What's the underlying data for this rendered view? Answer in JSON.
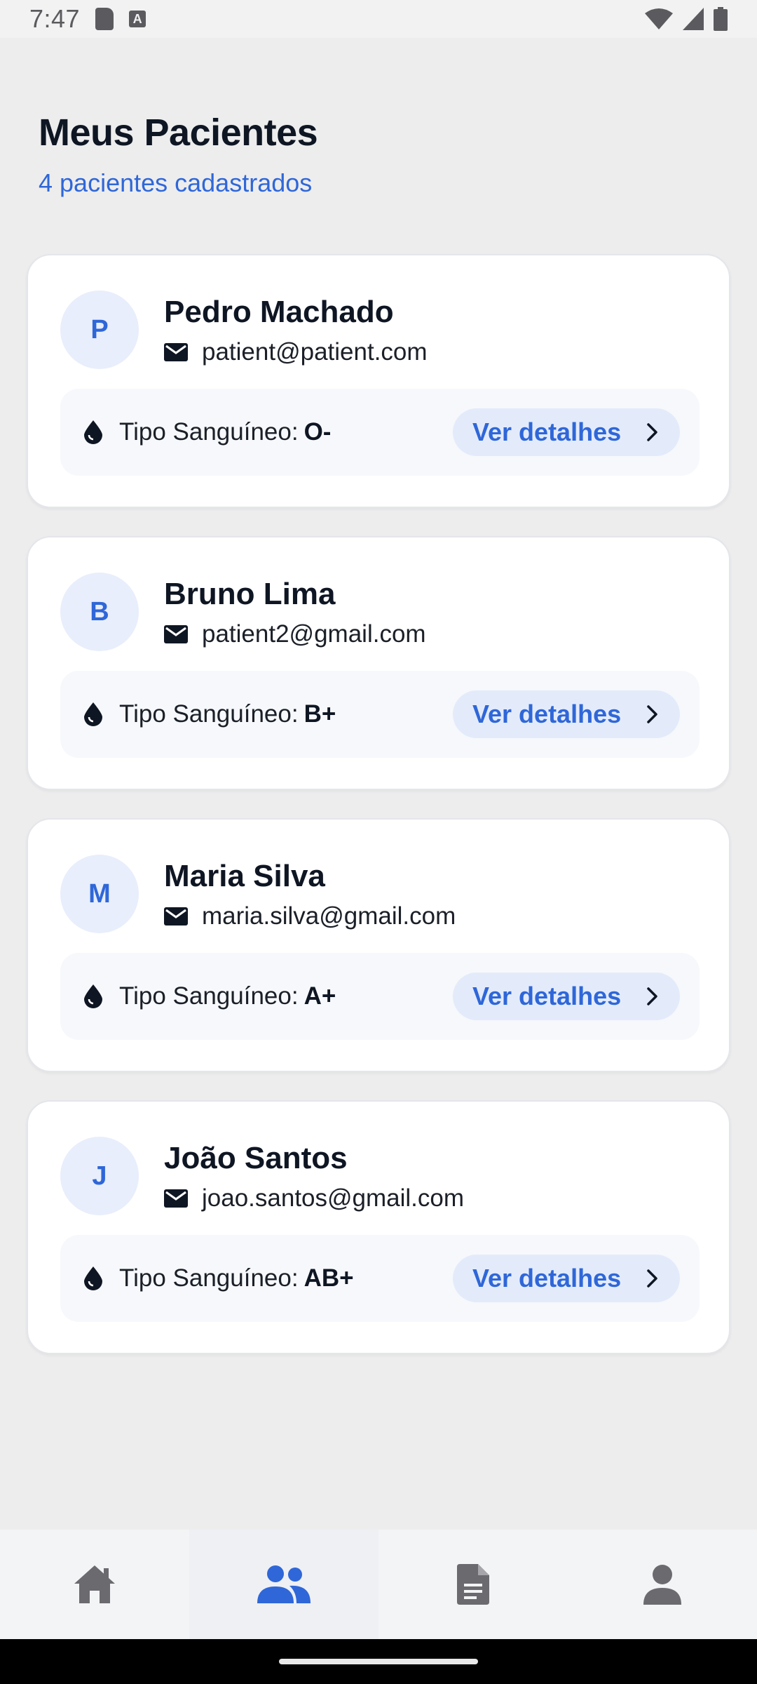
{
  "status_bar": {
    "time": "7:47",
    "a_icon_letter": "A"
  },
  "header": {
    "title": "Meus Pacientes",
    "subtitle": "4 pacientes cadastrados"
  },
  "patients": [
    {
      "initial": "P",
      "name": "Pedro Machado",
      "email": "patient@patient.com",
      "blood_label": "Tipo Sanguíneo:",
      "blood_type": "O-",
      "button_label": "Ver detalhes"
    },
    {
      "initial": "B",
      "name": "Bruno Lima",
      "email": "patient2@gmail.com",
      "blood_label": "Tipo Sanguíneo:",
      "blood_type": "B+",
      "button_label": "Ver detalhes"
    },
    {
      "initial": "M",
      "name": "Maria Silva",
      "email": "maria.silva@gmail.com",
      "blood_label": "Tipo Sanguíneo:",
      "blood_type": "A+",
      "button_label": "Ver detalhes"
    },
    {
      "initial": "J",
      "name": "João Santos",
      "email": "joao.santos@gmail.com",
      "blood_label": "Tipo Sanguíneo:",
      "blood_type": "AB+",
      "button_label": "Ver detalhes"
    }
  ],
  "bottom_nav": {
    "items": [
      {
        "icon": "home-icon",
        "active": false
      },
      {
        "icon": "people-icon",
        "active": true
      },
      {
        "icon": "document-icon",
        "active": false
      },
      {
        "icon": "person-icon",
        "active": false
      }
    ]
  },
  "colors": {
    "accent": "#2f67d8",
    "inactive_icon": "#6b6b6f",
    "background": "#ededee"
  }
}
